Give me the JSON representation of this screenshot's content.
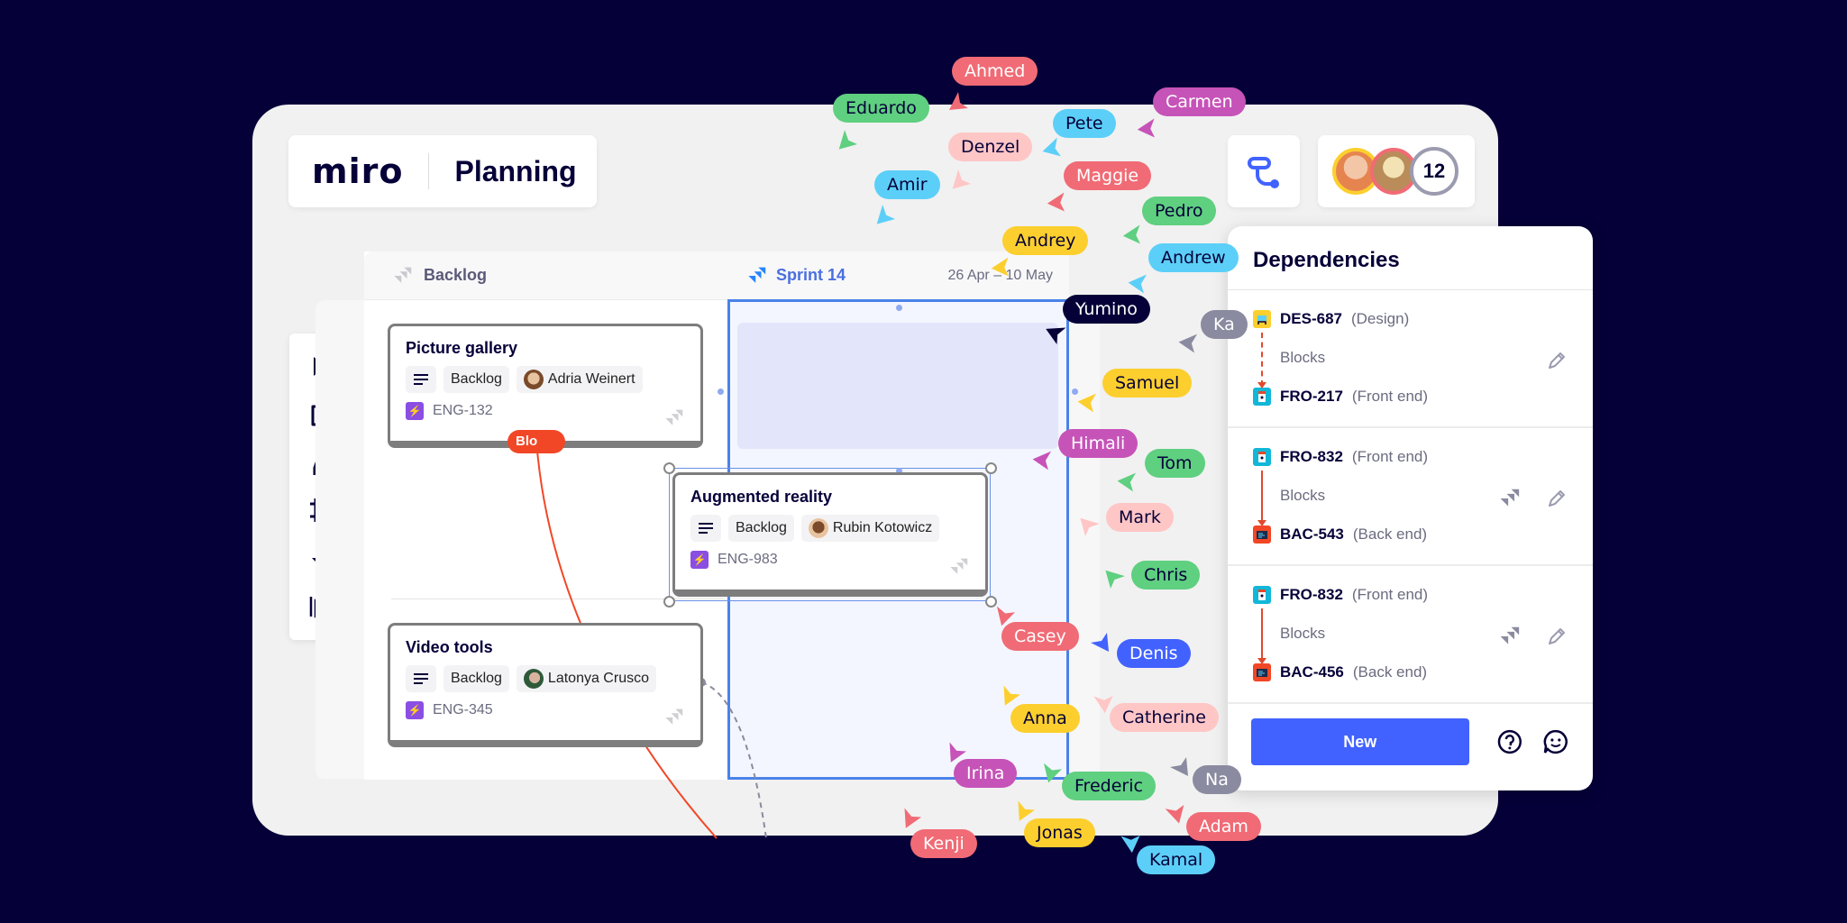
{
  "header": {
    "logo": "miro",
    "title": "Planning"
  },
  "collaborators": {
    "overflow_count": "12",
    "ring_colors": [
      "#fccf2e",
      "#f06b75",
      "#9b9bb0"
    ]
  },
  "toolbar": {
    "tools": [
      "select",
      "sticky-note",
      "pen",
      "frame",
      "jira",
      "kanban"
    ]
  },
  "lanes": {
    "backlog": {
      "label": "Backlog"
    },
    "sprint": {
      "label": "Sprint 14",
      "dates": "26 Apr – 10 May",
      "color": "#4262ff"
    }
  },
  "cards": [
    {
      "title": "Picture gallery",
      "status": "Backlog",
      "assignee": "Adria Weinert",
      "key": "ENG-132"
    },
    {
      "title": "Augmented reality",
      "status": "Backlog",
      "assignee": "Rubin Kotowicz",
      "key": "ENG-983"
    },
    {
      "title": "Video tools",
      "status": "Backlog",
      "assignee": "Latonya Crusco",
      "key": "ENG-345"
    }
  ],
  "connector_label": "Blo",
  "dependencies": {
    "title": "Dependencies",
    "items": [
      {
        "from_id": "DES-687",
        "from_group": "(Design)",
        "relation": "Blocks",
        "to_id": "FRO-217",
        "to_group": "(Front end)",
        "line": "dashed",
        "jira": false
      },
      {
        "from_id": "FRO-832",
        "from_group": "(Front end)",
        "relation": "Blocks",
        "to_id": "BAC-543",
        "to_group": "(Back end)",
        "line": "solid",
        "jira": true
      },
      {
        "from_id": "FRO-832",
        "from_group": "(Front end)",
        "relation": "Blocks",
        "to_id": "BAC-456",
        "to_group": "(Back end)",
        "line": "solid",
        "jira": true
      }
    ],
    "new_label": "New"
  },
  "cursors": [
    {
      "name": "Ahmed",
      "color": "#f06b75",
      "text": "#fff"
    },
    {
      "name": "Eduardo",
      "color": "#5fcf80",
      "text": "#050038"
    },
    {
      "name": "Carmen",
      "color": "#c653b8",
      "text": "#fff"
    },
    {
      "name": "Pete",
      "color": "#5ccff8",
      "text": "#050038"
    },
    {
      "name": "Denzel",
      "color": "#ffc6c6",
      "text": "#050038"
    },
    {
      "name": "Amir",
      "color": "#5ccff8",
      "text": "#050038"
    },
    {
      "name": "Maggie",
      "color": "#f06b75",
      "text": "#fff"
    },
    {
      "name": "Pedro",
      "color": "#5fcf80",
      "text": "#050038"
    },
    {
      "name": "Andrey",
      "color": "#fccf2e",
      "text": "#050038"
    },
    {
      "name": "Andrew",
      "color": "#5ccff8",
      "text": "#050038"
    },
    {
      "name": "Yumino",
      "color": "#050038",
      "text": "#fff"
    },
    {
      "name": "Ka",
      "color": "#8a8aa0",
      "text": "#fff"
    },
    {
      "name": "Samuel",
      "color": "#fccf2e",
      "text": "#050038"
    },
    {
      "name": "Himali",
      "color": "#c653b8",
      "text": "#fff"
    },
    {
      "name": "Tom",
      "color": "#5fcf80",
      "text": "#050038"
    },
    {
      "name": "Mark",
      "color": "#ffc6c6",
      "text": "#050038"
    },
    {
      "name": "Chris",
      "color": "#5fcf80",
      "text": "#050038"
    },
    {
      "name": "Casey",
      "color": "#f06b75",
      "text": "#fff"
    },
    {
      "name": "Denis",
      "color": "#4262ff",
      "text": "#fff"
    },
    {
      "name": "Anna",
      "color": "#fccf2e",
      "text": "#050038"
    },
    {
      "name": "Catherine",
      "color": "#ffc6c6",
      "text": "#050038"
    },
    {
      "name": "Irina",
      "color": "#c653b8",
      "text": "#fff"
    },
    {
      "name": "Frederic",
      "color": "#5fcf80",
      "text": "#050038"
    },
    {
      "name": "Na",
      "color": "#8a8aa0",
      "text": "#fff"
    },
    {
      "name": "Kenji",
      "color": "#f06b75",
      "text": "#fff"
    },
    {
      "name": "Jonas",
      "color": "#fccf2e",
      "text": "#050038"
    },
    {
      "name": "Adam",
      "color": "#f06b75",
      "text": "#fff"
    },
    {
      "name": "Kamal",
      "color": "#5ccff8",
      "text": "#050038"
    }
  ]
}
